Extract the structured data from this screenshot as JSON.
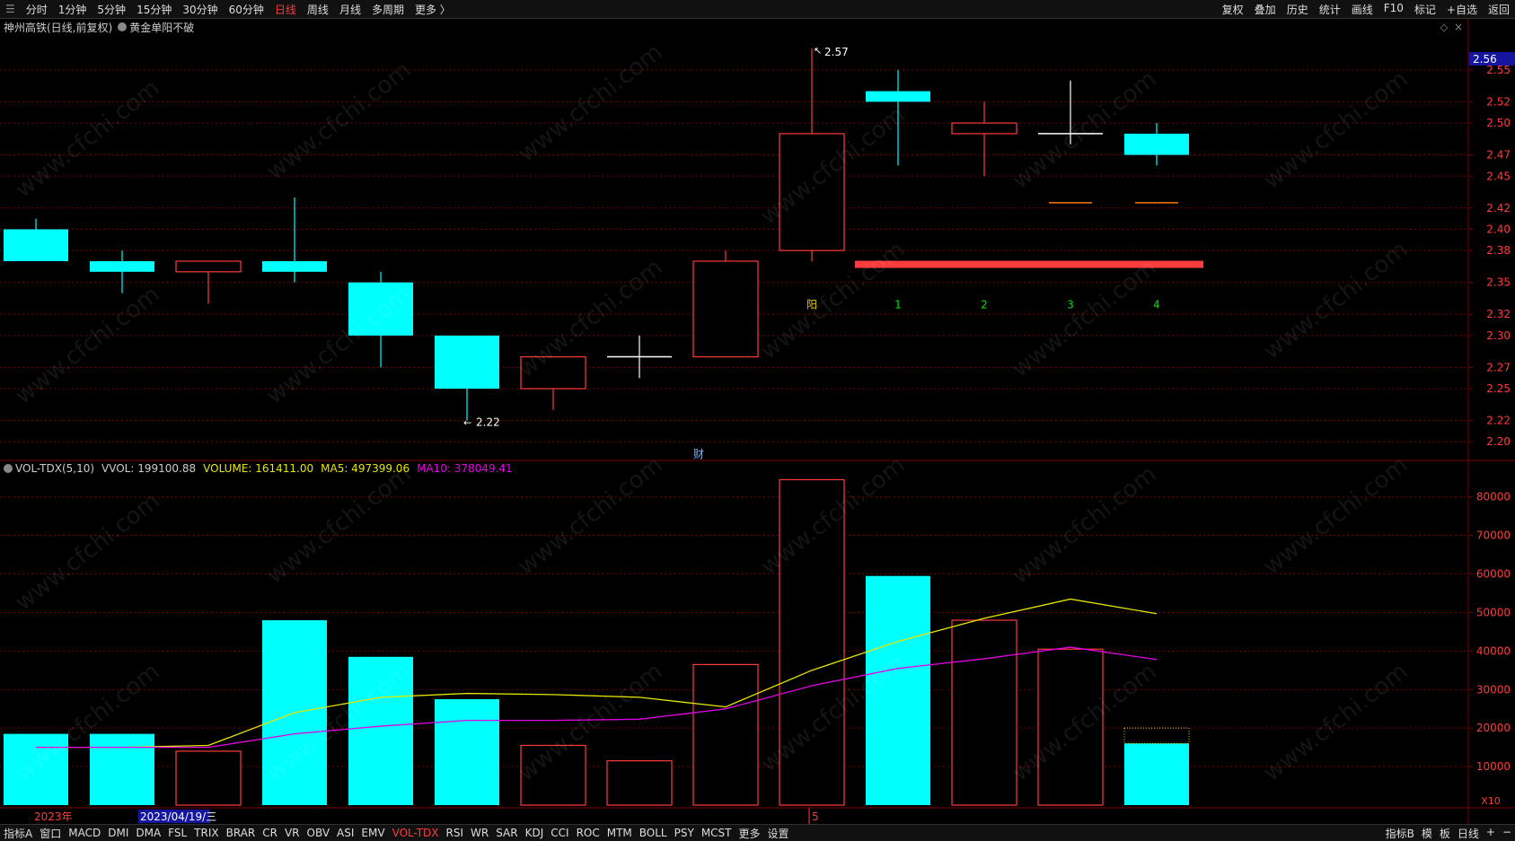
{
  "topbar": {
    "periods": [
      "分时",
      "1分钟",
      "5分钟",
      "15分钟",
      "30分钟",
      "60分钟",
      "日线",
      "周线",
      "月线",
      "多周期",
      "更多 〉"
    ],
    "active_period": "日线",
    "right_items": [
      "复权",
      "叠加",
      "历史",
      "统计",
      "画线",
      "F10",
      "标记",
      "+自选",
      "返回"
    ]
  },
  "title": {
    "stock": "神州高铁(日线,前复权)",
    "indicator": "黄金单阳不破"
  },
  "price_axis": {
    "ticks": [
      "2.55",
      "2.52",
      "2.50",
      "2.47",
      "2.45",
      "2.42",
      "2.40",
      "2.38",
      "2.35",
      "2.32",
      "2.30",
      "2.27",
      "2.25",
      "2.22",
      "2.20"
    ],
    "current": "2.56"
  },
  "price_labels": {
    "high": "2.57",
    "low": "2.22",
    "finance_marker": "财"
  },
  "signal_labels": [
    "阳",
    "1",
    "2",
    "3",
    "4"
  ],
  "volume_header": {
    "name": "VOL-TDX(5,10)",
    "vvol": "VVOL: 199100.88",
    "volume": "VOLUME: 161411.00",
    "ma5": "MA5: 497399.06",
    "ma10": "MA10: 378049.41"
  },
  "volume_axis": {
    "ticks": [
      "80000",
      "70000",
      "60000",
      "50000",
      "40000",
      "30000",
      "20000",
      "10000"
    ],
    "unit": "X10"
  },
  "date_axis": {
    "left": "2023年",
    "cursor": "2023/04/19/三",
    "mid": "5"
  },
  "bottombar": {
    "items": [
      "指标A",
      "窗口",
      "MACD",
      "DMI",
      "DMA",
      "FSL",
      "TRIX",
      "BRAR",
      "CR",
      "VR",
      "OBV",
      "ASI",
      "EMV",
      "VOL-TDX",
      "RSI",
      "WR",
      "SAR",
      "KDJ",
      "CCI",
      "ROC",
      "MTM",
      "BOLL",
      "PSY",
      "MCST",
      "更多",
      "设置"
    ],
    "active": "VOL-TDX",
    "right_items": [
      "指标B",
      "模",
      "板",
      "日线",
      "+",
      "−"
    ]
  },
  "colors": {
    "up": "#ff3b3b",
    "down": "#00ffff",
    "ma5": "#e6e600",
    "ma10": "#e600e6",
    "grid": "#7a0000"
  },
  "chart_data": {
    "type": "candlestick",
    "candles": [
      {
        "o": 2.4,
        "h": 2.41,
        "l": 2.37,
        "c": 2.37,
        "v": 18500
      },
      {
        "o": 2.37,
        "h": 2.38,
        "l": 2.34,
        "c": 2.36,
        "v": 18500
      },
      {
        "o": 2.36,
        "h": 2.37,
        "l": 2.33,
        "c": 2.37,
        "v": 14000
      },
      {
        "o": 2.37,
        "h": 2.43,
        "l": 2.35,
        "c": 2.36,
        "v": 48000
      },
      {
        "o": 2.35,
        "h": 2.36,
        "l": 2.27,
        "c": 2.3,
        "v": 38500
      },
      {
        "o": 2.3,
        "h": 2.3,
        "l": 2.22,
        "c": 2.25,
        "v": 27500
      },
      {
        "o": 2.25,
        "h": 2.28,
        "l": 2.23,
        "c": 2.28,
        "v": 15500
      },
      {
        "o": 2.28,
        "h": 2.3,
        "l": 2.26,
        "c": 2.28,
        "v": 11500
      },
      {
        "o": 2.28,
        "h": 2.38,
        "l": 2.28,
        "c": 2.37,
        "v": 36500
      },
      {
        "o": 2.38,
        "h": 2.57,
        "l": 2.37,
        "c": 2.49,
        "v": 84500
      },
      {
        "o": 2.53,
        "h": 2.55,
        "l": 2.46,
        "c": 2.52,
        "v": 59500
      },
      {
        "o": 2.49,
        "h": 2.52,
        "l": 2.45,
        "c": 2.5,
        "v": 48000
      },
      {
        "o": 2.49,
        "h": 2.54,
        "l": 2.48,
        "c": 2.49,
        "v": 40500
      },
      {
        "o": 2.49,
        "h": 2.5,
        "l": 2.46,
        "c": 2.47,
        "v": 16000
      }
    ],
    "ma5": [
      15000,
      15000,
      15500,
      24000,
      28000,
      29000,
      28700,
      28000,
      25500,
      35000,
      42500,
      48500,
      53500,
      49700
    ],
    "ma10": [
      15000,
      15000,
      15000,
      18500,
      20500,
      22000,
      22000,
      22300,
      25000,
      31000,
      35500,
      38000,
      41000,
      37800
    ],
    "price_ylim": [
      2.185,
      2.582
    ],
    "volume_ylim": [
      0,
      86000
    ]
  }
}
